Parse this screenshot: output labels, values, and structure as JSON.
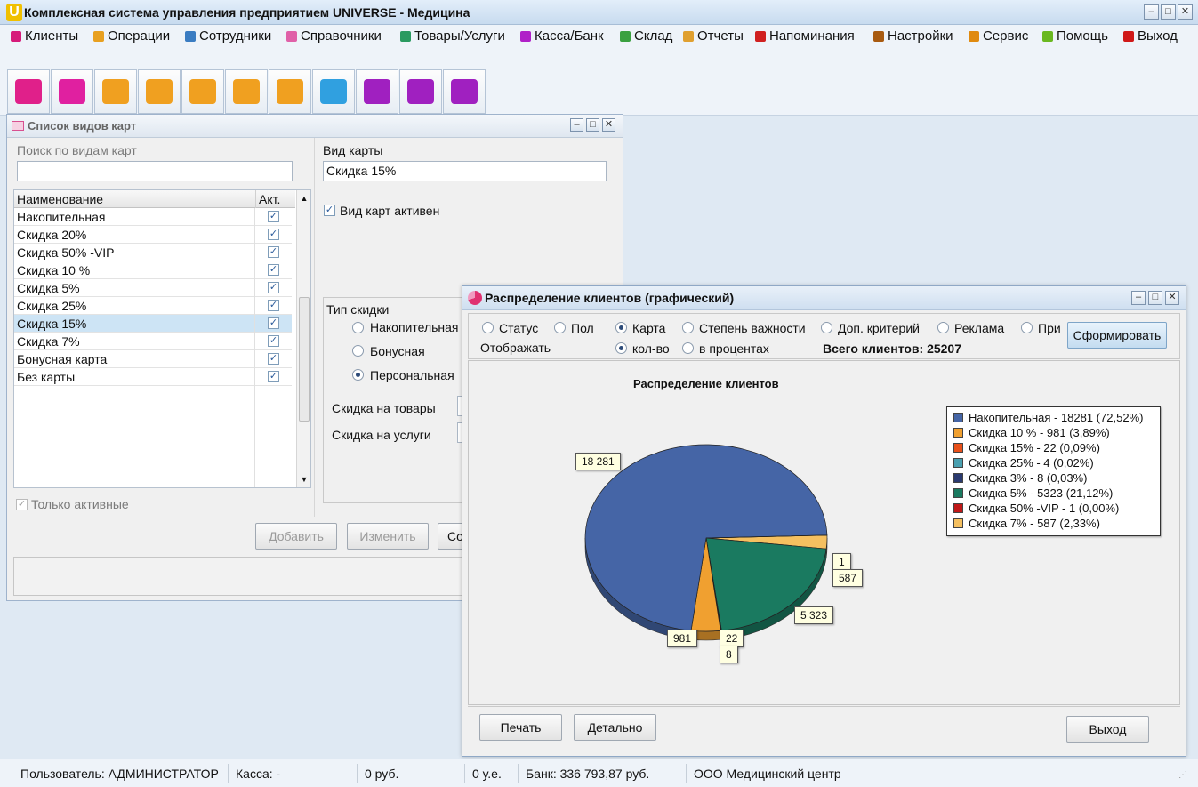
{
  "window": {
    "title": "Комплексная система управления предприятием UNIVERSE - Медицина",
    "logo": "U"
  },
  "menu": [
    {
      "label": "Клиенты",
      "icon": "clients-icon",
      "color": "#d61b7a"
    },
    {
      "label": "Операции",
      "icon": "operations-icon",
      "color": "#e8a020"
    },
    {
      "label": "Сотрудники",
      "icon": "employees-icon",
      "color": "#3a7cc2"
    },
    {
      "label": "Справочники",
      "icon": "references-icon",
      "color": "#e060a8"
    },
    {
      "label": "Товары/Услуги",
      "icon": "goods-icon",
      "color": "#2a9a60"
    },
    {
      "label": "Касса/Банк",
      "icon": "cash-icon",
      "color": "#b020c8"
    },
    {
      "label": "Склад",
      "icon": "warehouse-icon",
      "color": "#3aa040"
    },
    {
      "label": "Отчеты",
      "icon": "reports-icon",
      "color": "#e0a030"
    },
    {
      "label": "Напоминания",
      "icon": "reminders-icon",
      "color": "#d02020"
    },
    {
      "label": "Настройки",
      "icon": "settings-icon",
      "color": "#a85a10"
    },
    {
      "label": "Сервис",
      "icon": "service-icon",
      "color": "#e08a10"
    },
    {
      "label": "Помощь",
      "icon": "help-icon",
      "color": "#6ab820"
    },
    {
      "label": "Выход",
      "icon": "exit-icon",
      "color": "#d01818"
    }
  ],
  "toolbar": [
    {
      "icon": "client-card-icon",
      "color": "#e0208a"
    },
    {
      "icon": "medical-kit-icon",
      "color": "#e020a0"
    },
    {
      "icon": "staff-icon",
      "color": "#f0a020"
    },
    {
      "icon": "wallet-icon",
      "color": "#f0a020"
    },
    {
      "icon": "font-icon",
      "color": "#f0a020"
    },
    {
      "icon": "phone-icon",
      "color": "#f0a020"
    },
    {
      "icon": "calendar-icon",
      "color": "#f0a020"
    },
    {
      "icon": "schedule-grid-icon",
      "color": "#30a0e0"
    },
    {
      "icon": "money-bag-icon",
      "color": "#a020c0"
    },
    {
      "icon": "calendar-purple-icon",
      "color": "#a020c0"
    },
    {
      "icon": "coins-icon",
      "color": "#a020c0"
    }
  ],
  "cards": {
    "title": "Список видов карт",
    "search_label": "Поиск по видам карт",
    "search_value": "",
    "col_name": "Наименование",
    "col_active": "Акт.",
    "rows": [
      {
        "name": "Накопительная",
        "active": true
      },
      {
        "name": "Скидка 20%",
        "active": true
      },
      {
        "name": "Скидка 50% -VIP",
        "active": true
      },
      {
        "name": "Скидка 10 %",
        "active": true
      },
      {
        "name": "Скидка 5%",
        "active": true
      },
      {
        "name": "Скидка 25%",
        "active": true
      },
      {
        "name": "Скидка 15%",
        "active": true,
        "selected": true
      },
      {
        "name": "Скидка 7%",
        "active": true
      },
      {
        "name": "Бонусная карта",
        "active": true
      },
      {
        "name": "Без карты",
        "active": true
      }
    ],
    "only_active": "Только активные",
    "card_type_label": "Вид карты",
    "card_type_value": "Скидка 15%",
    "card_active_label": "Вид карт активен",
    "discount_type_label": "Тип скидки",
    "discount_types": [
      "Накопительная",
      "Бонусная",
      "Персональная"
    ],
    "discount_goods": "Скидка на товары",
    "discount_services": "Скидка на услуги",
    "add_button": "Добавить",
    "edit_button": "Изменить",
    "save_button": "Со"
  },
  "chart_window": {
    "title": "Распределение клиентов (графический)",
    "group_options": [
      "Статус",
      "Пол",
      "Карта",
      "Степень важности",
      "Доп. критерий",
      "Реклама",
      "При"
    ],
    "show_label": "Отображать",
    "show_options": [
      "кол-во",
      "в процентах"
    ],
    "total_label": "Всего клиентов: 25207",
    "build_button": "Сформировать",
    "print_button": "Печать",
    "detail_button": "Детально",
    "exit_button": "Выход"
  },
  "chart_data": {
    "type": "pie",
    "title": "Распределение клиентов",
    "labels": [
      "Накопительная",
      "Скидка 10 %",
      "Скидка 15%",
      "Скидка 25%",
      "Скидка 3%",
      "Скидка 5%",
      "Скидка 50% -VIP",
      "Скидка 7%"
    ],
    "values": [
      18281,
      981,
      22,
      4,
      8,
      5323,
      1,
      587
    ],
    "value_labels": [
      "18 281",
      "981",
      "22",
      "",
      "8",
      "5 323",
      "1",
      "587"
    ],
    "legend": [
      "Накопительная - 18281 (72,52%)",
      "Скидка 10 %  - 981 (3,89%)",
      "Скидка 15% - 22 (0,09%)",
      "Скидка 25% - 4 (0,02%)",
      "Скидка 3% - 8 (0,03%)",
      "Скидка 5% - 5323 (21,12%)",
      "Скидка 50% -VIP - 1 (0,00%)",
      "Скидка 7% - 587 (2,33%)"
    ],
    "colors": [
      "#4565a6",
      "#f0a030",
      "#e8501a",
      "#4aa0b0",
      "#2a3a70",
      "#1a7a60",
      "#c01818",
      "#f5c060"
    ],
    "legend_position": "right"
  },
  "status": {
    "user": "Пользователь: АДМИНИСТРАТОР",
    "cash": "Касса: -",
    "rub": "0 руб.",
    "ue": "0 у.е.",
    "bank": "Банк: 336 793,87 руб.",
    "org": "ООО Медицинский центр"
  }
}
